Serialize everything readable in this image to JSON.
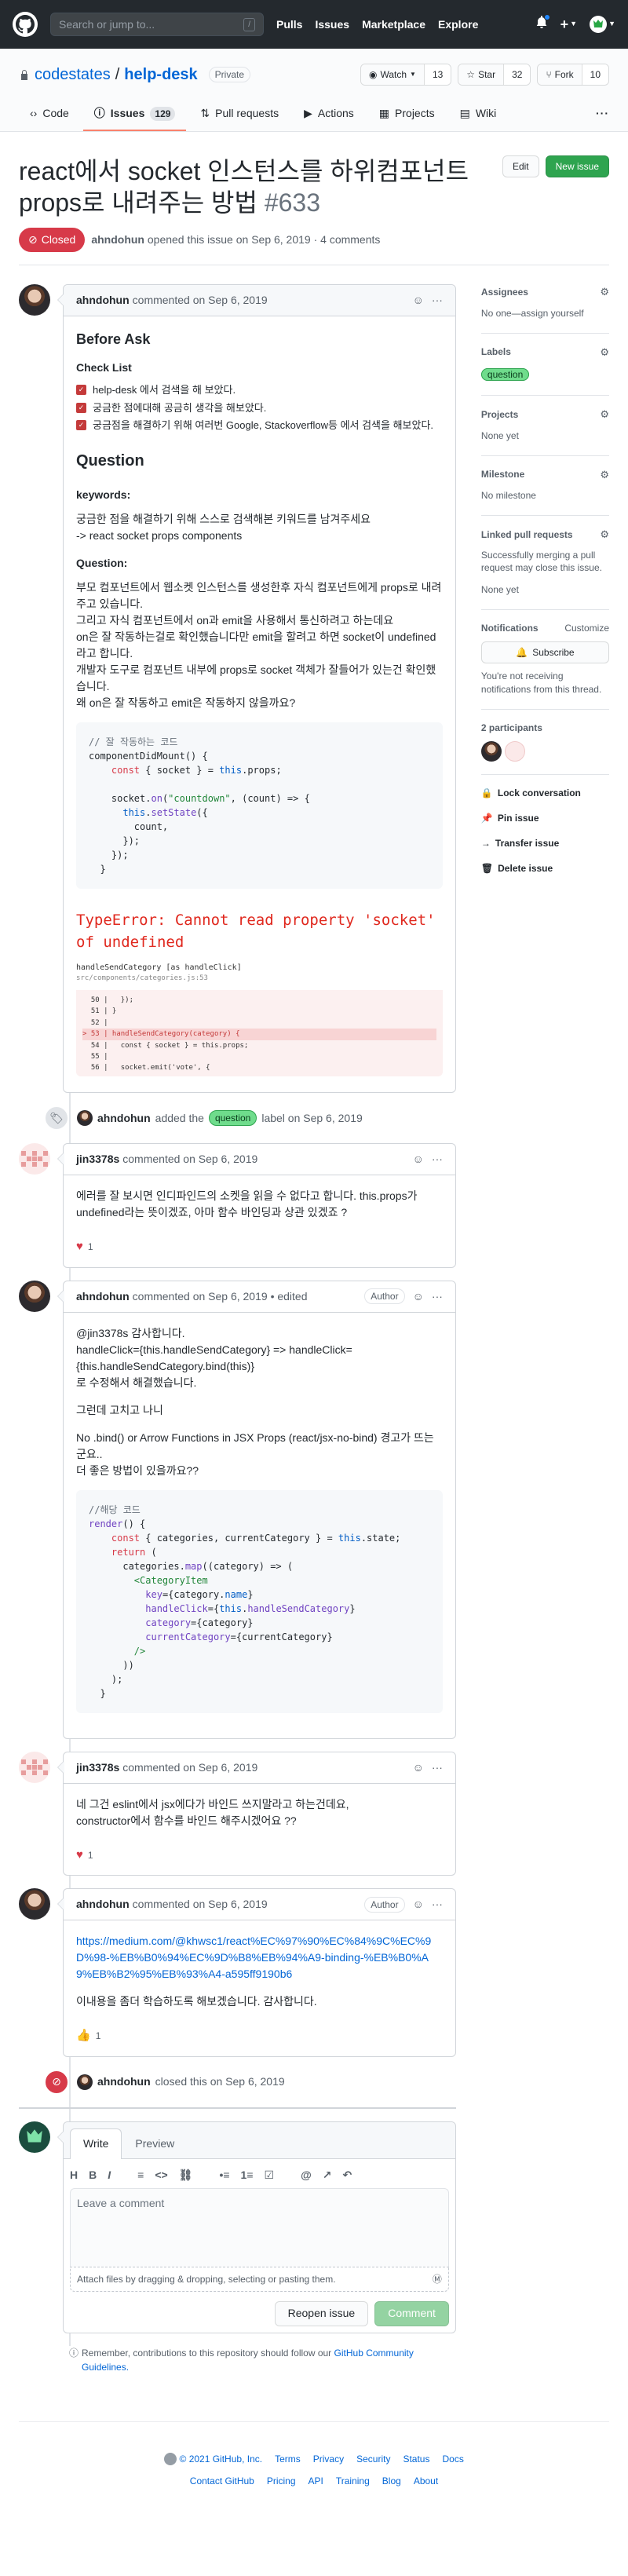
{
  "header": {
    "search_placeholder": "Search or jump to...",
    "search_key": "/",
    "nav": [
      "Pulls",
      "Issues",
      "Marketplace",
      "Explore"
    ],
    "plus": "+"
  },
  "repo": {
    "owner": "codestates",
    "separator": "/",
    "name": "help-desk",
    "visibility": "Private",
    "watch_label": "Watch",
    "watch_count": "13",
    "star_label": "Star",
    "star_count": "32",
    "fork_label": "Fork",
    "fork_count": "10",
    "tabs": [
      {
        "label": "Code",
        "icon": "code-icon"
      },
      {
        "label": "Issues",
        "count": "129",
        "icon": "issue-icon"
      },
      {
        "label": "Pull requests",
        "icon": "pull-request-icon"
      },
      {
        "label": "Actions",
        "icon": "play-icon"
      },
      {
        "label": "Projects",
        "icon": "project-icon"
      },
      {
        "label": "Wiki",
        "icon": "book-icon"
      }
    ],
    "more": "···"
  },
  "issue": {
    "title": "react에서 socket 인스턴스를 하위컴포넌트 props로 내려주는 방법",
    "number": "#633",
    "edit_label": "Edit",
    "new_issue_label": "New issue",
    "state": "Closed",
    "author": "ahndohun",
    "meta_text": "opened this issue on Sep 6, 2019 · 4 comments"
  },
  "comments": {
    "c1": {
      "author": "ahndohun",
      "date": "commented on Sep 6, 2019",
      "h_before": "Before Ask",
      "h_checklist": "Check List",
      "checklist": [
        "help-desk 에서 검색을 해 보았다.",
        "궁금한 점에대해 공금히 생각을 해보았다.",
        "궁금점을 해결하기 위해 여러번 Google, Stackoverflow등 에서 검색을 해보았다."
      ],
      "h_question": "Question",
      "h_keywords": "keywords:",
      "keywords_line1": "궁금한 점을 해결하기 위해 스스로 검색해본 키워드를 남겨주세요",
      "keywords_line2": "-> react socket props components",
      "h_question2": "Question:",
      "question_text": "부모 컴포넌트에서 웹소켓 인스턴스를 생성한후 자식 컴포넌트에게 props로 내려주고 있습니다.\n그리고 자식 컴포넌트에서 on과 emit을 사용해서 통신하려고 하는데요\non은 잘 작동하는걸로 확인했습니다만 emit을 할려고 하면 socket이 undefined라고 합니다.\n개발자 도구로 컴포넌트 내부에 props로 socket 객체가 잘들어가 있는건 확인했습니다.\n왜 on은 잘 작동하고 emit은 작동하지 않을까요?",
      "error_title": "TypeError: Cannot read property 'socket' of undefined",
      "error_sub": "handleSendCategory [as handleClick]",
      "error_file": "src/components/categories.js:53",
      "error_lines": [
        "  50 |   });",
        "  51 | }",
        "  52 |",
        "> 53 | handleSendCategory(category) {",
        "  54 |   const { socket } = this.props;",
        "  55 |",
        "  56 |   socket.emit('vote', {"
      ]
    },
    "label_event": {
      "actor": "ahndohun",
      "action": "added the",
      "label": "question",
      "suffix": "label on Sep 6, 2019"
    },
    "c2": {
      "author": "jin3378s",
      "date": "commented on Sep 6, 2019",
      "body": "에러를 잘 보시면 인디파인드의 소켓을 읽을 수 없다고 합니다. this.props가 undefined라는 뜻이겠죠, 아마 함수 바인딩과 상관 있겠죠 ?",
      "reaction": "1"
    },
    "c3": {
      "author": "ahndohun",
      "date": "commented on Sep 6, 2019",
      "edited": "• edited",
      "badge": "Author",
      "p1": "@jin3378s 감사합니다.\nhandleClick={this.handleSendCategory} => handleClick={this.handleSendCategory.bind(this)}\n로 수정해서 해결했습니다.",
      "p2": "그런데 고치고 나니",
      "p3": "No .bind() or Arrow Functions in JSX Props (react/jsx-no-bind) 경고가 뜨는군요..\n더 좋은 방법이 있을까요??"
    },
    "c4": {
      "author": "jin3378s",
      "date": "commented on Sep 6, 2019",
      "body": "네 그건 eslint에서 jsx에다가 바인드 쓰지말라고 하는건데요,\nconstructor에서 함수를 바인드 해주시겠어요 ??",
      "reaction": "1"
    },
    "c5": {
      "author": "ahndohun",
      "date": "commented on Sep 6, 2019",
      "badge": "Author",
      "link": "https://medium.com/@khwsc1/react%EC%97%90%EC%84%9C%EC%9D%98-%EB%B0%94%EC%9D%B8%EB%94%A9-binding-%EB%B0%A9%EB%B2%95%EB%93%A4-a595ff9190b6",
      "body": "이내용을 좀더 학습하도록 해보겠습니다. 감사합니다.",
      "reaction": "1"
    },
    "closed_event": {
      "actor": "ahndohun",
      "text": "closed this on Sep 6, 2019"
    }
  },
  "new_comment": {
    "tab_write": "Write",
    "tab_preview": "Preview",
    "toolbar": [
      "H",
      "B",
      "I",
      "≡",
      "<>",
      "⛓",
      "•≡",
      "1≡",
      "☑",
      "@",
      "↗",
      "↶"
    ],
    "placeholder": "Leave a comment",
    "attach": "Attach files by dragging & dropping, selecting or pasting them.",
    "reopen_label": "Reopen issue",
    "comment_label": "Comment",
    "remember": "Remember, contributions to this repository should follow our",
    "guidelines": "GitHub Community Guidelines."
  },
  "sidebar": {
    "assignees": "Assignees",
    "assignees_val": "No one—assign yourself",
    "labels": "Labels",
    "label_val": "question",
    "projects": "Projects",
    "projects_val": "None yet",
    "milestone": "Milestone",
    "milestone_val": "No milestone",
    "linked": "Linked pull requests",
    "linked_note": "Successfully merging a pull request may close this issue.",
    "linked_val": "None yet",
    "notifications": "Notifications",
    "customize": "Customize",
    "subscribe": "Subscribe",
    "notif_note": "You're not receiving notifications from this thread.",
    "participants": "2 participants",
    "lock": "Lock conversation",
    "pin": "Pin issue",
    "transfer": "Transfer issue",
    "delete": "Delete issue"
  },
  "footer": {
    "copyright": "© 2021 GitHub, Inc.",
    "row1": [
      "Terms",
      "Privacy",
      "Security",
      "Status",
      "Docs"
    ],
    "row2": [
      "Contact GitHub",
      "Pricing",
      "API",
      "Training",
      "Blog",
      "About"
    ]
  },
  "colors": {
    "closed": "#d73a49",
    "green": "#2ea44f",
    "link": "#0366d6",
    "error": "#e0281e"
  }
}
